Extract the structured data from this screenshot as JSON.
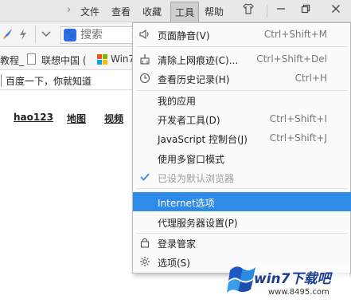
{
  "menubar": {
    "items": [
      "文件",
      "查看",
      "收藏",
      "工具",
      "帮助"
    ],
    "active_index": 3
  },
  "window_buttons": {
    "skin": "shirt-icon",
    "minimize": "minimize-icon",
    "restore": "restore-icon",
    "close": "close-icon"
  },
  "toolbar": {
    "search_placeholder": "搜索"
  },
  "bookmarks": {
    "items": [
      "教程_",
      "联想中国 (",
      "Win7"
    ]
  },
  "page": {
    "tab_title": "百度一下，你就知道",
    "nav_links": [
      "hao123",
      "地图",
      "视频"
    ]
  },
  "tools_menu": {
    "items": [
      {
        "icon": "speaker-icon",
        "label": "页面静音(V)",
        "shortcut": "Ctrl+Shift+M",
        "disabled": false,
        "highlighted": false
      },
      {
        "icon": "broom-icon",
        "label": "清除上网痕迹(C)...",
        "shortcut": "Ctrl+Shift+Del",
        "disabled": false,
        "highlighted": false
      },
      {
        "icon": "clock-icon",
        "label": "查看历史记录(H)",
        "shortcut": "Ctrl+H",
        "disabled": false,
        "highlighted": false
      },
      {
        "icon": "",
        "label": "我的应用",
        "shortcut": "",
        "disabled": false,
        "highlighted": false
      },
      {
        "icon": "",
        "label": "开发者工具(D)",
        "shortcut": "Ctrl+Shift+I",
        "disabled": false,
        "highlighted": false
      },
      {
        "icon": "",
        "label": "JavaScript 控制台(J)",
        "shortcut": "Ctrl+Shift+J",
        "disabled": false,
        "highlighted": false
      },
      {
        "icon": "",
        "label": "使用多窗口模式",
        "shortcut": "",
        "disabled": false,
        "highlighted": false
      },
      {
        "icon": "check-icon",
        "label": "已设为默认浏览器",
        "shortcut": "",
        "disabled": true,
        "highlighted": false
      },
      {
        "icon": "",
        "label": "Internet选项",
        "shortcut": "",
        "disabled": false,
        "highlighted": true
      },
      {
        "icon": "",
        "label": "代理服务器设置(P)",
        "shortcut": "",
        "disabled": false,
        "highlighted": false
      },
      {
        "icon": "lock-icon",
        "label": "登录管家",
        "shortcut": "",
        "disabled": false,
        "highlighted": false
      },
      {
        "icon": "gear-icon",
        "label": "选项(S)",
        "shortcut": "",
        "disabled": false,
        "highlighted": false
      }
    ]
  },
  "watermark": {
    "title": "win7下载吧",
    "url": "www.8495.com"
  },
  "colors": {
    "highlight": "#2f8be8",
    "check": "#2f8be8",
    "watermark_blue": "#1a3d8f"
  }
}
